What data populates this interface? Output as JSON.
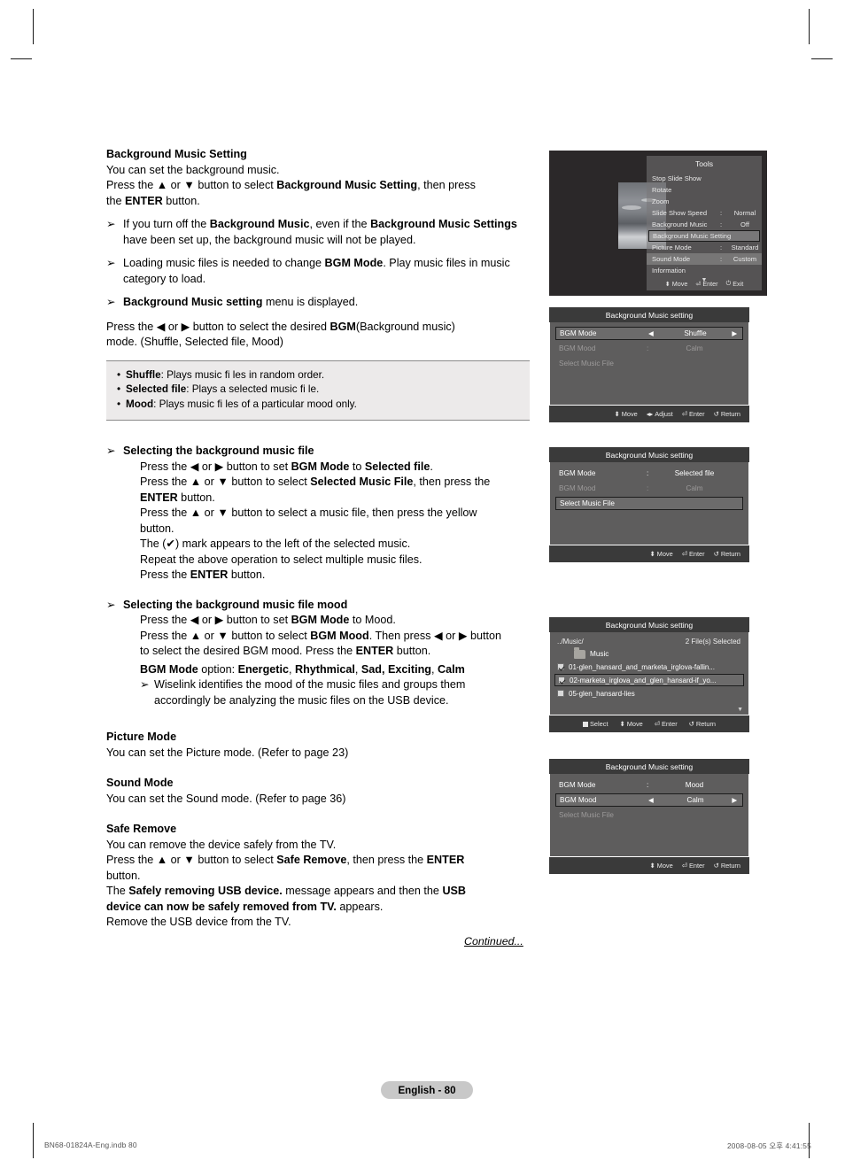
{
  "doc": {
    "page_badge": "English - 80",
    "continued": "Continued...",
    "footer_left": "BN68-01824A-Eng.indb   80",
    "footer_right": "2008-08-05   오후 4:41:55"
  },
  "sections": {
    "bg_music_setting": {
      "title": "Background Music Setting",
      "line1": "You can set the background music.",
      "line2_a": "Press the ▲ or ▼ button to select ",
      "line2_b": "Background Music Setting",
      "line2_c": ", then press",
      "line3_a": "the ",
      "line3_b": "ENTER",
      "line3_c": " button.",
      "bullets": [
        {
          "a": "If you turn off the ",
          "b": "Background Music",
          "c": ", even if the ",
          "d": "Background Music",
          "e": "Settings",
          "f": " have been set up, the background music will not be played."
        },
        {
          "a": "Loading music files is needed to change ",
          "b": "BGM Mode",
          "c": ". Play music files in",
          "d": "music category to load."
        },
        {
          "a": "Background Music setting",
          "b": " menu is displayed."
        }
      ],
      "after_a": "Press the ◀ or ▶ button to select the desired ",
      "after_b": "BGM",
      "after_c": "(Background music)",
      "after_d": "mode. (Shuffle, Selected file, Mood)"
    },
    "infobox": [
      {
        "term": "Shuffle",
        "text": ": Plays music fi les in random order."
      },
      {
        "term": "Selected file",
        "text": ": Plays a selected music fi le."
      },
      {
        "term": "Mood",
        "text": ": Plays music fi les of a particular mood only."
      }
    ],
    "selecting_file": {
      "heading": "Selecting the background music file",
      "l1_a": "Press the ◀ or ▶ button to set ",
      "l1_b": "BGM Mode",
      "l1_c": " to ",
      "l1_d": "Selected file",
      "l1_e": ".",
      "l2_a": "Press the ▲ or ▼ button to select ",
      "l2_b": "Selected Music File",
      "l2_c": ", then press the",
      "l3_a": "ENTER",
      "l3_b": " button.",
      "l4": "Press the ▲ or ▼ button to select a music file, then press the yellow",
      "l5": "button.",
      "l6": "The (✔) mark appears to the left of the selected music.",
      "l7": "Repeat the above operation to select multiple music files.",
      "l8_a": "Press the ",
      "l8_b": "ENTER",
      "l8_c": " button."
    },
    "selecting_mood": {
      "heading": "Selecting the background music file mood",
      "l1_a": "Press the ◀ or ▶ button to set ",
      "l1_b": "BGM Mode",
      "l1_c": " to Mood.",
      "l2_a": "Press the ▲ or ▼ button to select ",
      "l2_b": "BGM Mood",
      "l2_c": ". Then press ◀ or ▶ button",
      "l3_a": "to select the desired BGM mood. Press the ",
      "l3_b": "ENTER",
      "l3_c": " button.",
      "opt_a": "BGM Mode",
      "opt_b": " option: ",
      "opt_c": "Energetic",
      "opt_d": ", ",
      "opt_e": "Rhythmical",
      "opt_f": ", ",
      "opt_g": "Sad, Exciting",
      "opt_h": ", ",
      "opt_i": "Calm",
      "note1": "Wiselink identifies the mood of the music files and groups them",
      "note2": "accordingly be analyzing the music files on the USB device."
    },
    "picture_mode": {
      "title": "Picture Mode",
      "text": "You can set the Picture mode. (Refer to page 23)"
    },
    "sound_mode": {
      "title": "Sound Mode",
      "text": "You can set the Sound mode. (Refer to page 36)"
    },
    "safe_remove": {
      "title": "Safe Remove",
      "l1": "You can remove the device safely from the TV.",
      "l2_a": "Press the ▲ or ▼ button to select ",
      "l2_b": "Safe Remove",
      "l2_c": ", then press the ",
      "l2_d": "ENTER",
      "l3": "button.",
      "l4_a": "The ",
      "l4_b": "Safely removing USB device.",
      "l4_c": " message appears and then the ",
      "l4_d": "USB",
      "l5_a": "device can now be safely removed from TV.",
      "l5_b": " appears.",
      "l6": "Remove the USB device from the TV."
    }
  },
  "screens": {
    "tools": {
      "title": "Tools",
      "items": [
        {
          "label": "Stop Slide Show",
          "colon": "",
          "value": "",
          "state": "normal"
        },
        {
          "label": "Rotate",
          "colon": "",
          "value": "",
          "state": "normal"
        },
        {
          "label": "Zoom",
          "colon": "",
          "value": "",
          "state": "normal"
        },
        {
          "label": "Slide Show Speed",
          "colon": ":",
          "value": "Normal",
          "state": "normal"
        },
        {
          "label": "Background Music",
          "colon": ":",
          "value": "Off",
          "state": "normal"
        },
        {
          "label": "Background Music Setting",
          "colon": "",
          "value": "",
          "state": "selected"
        },
        {
          "label": "Picture Mode",
          "colon": ":",
          "value": "Standard",
          "state": "normal"
        },
        {
          "label": "Sound Mode",
          "colon": ":",
          "value": "Custom",
          "state": "highlight"
        },
        {
          "label": "Information",
          "colon": "",
          "value": "",
          "state": "normal"
        }
      ],
      "scroll": "▼",
      "footer": [
        {
          "icon": "⬍",
          "label": "Move"
        },
        {
          "icon": "⏎",
          "label": "Enter"
        },
        {
          "icon": "⏻",
          "label": "Exit"
        }
      ]
    },
    "bgm_shuffle": {
      "title": "Background Music setting",
      "rows": [
        {
          "label": "BGM Mode",
          "colon": "",
          "value": "Shuffle",
          "arrows": true,
          "state": "selected"
        },
        {
          "label": "BGM Mood",
          "colon": ":",
          "value": "Calm",
          "arrows": false,
          "state": "dim"
        },
        {
          "label": "Select Music File",
          "colon": "",
          "value": "",
          "arrows": false,
          "state": "dim"
        }
      ],
      "footer": [
        {
          "icon": "⬍",
          "label": "Move"
        },
        {
          "icon": "◂▸",
          "label": "Adjust"
        },
        {
          "icon": "⏎",
          "label": "Enter"
        },
        {
          "icon": "↺",
          "label": "Return"
        }
      ]
    },
    "bgm_selected_file": {
      "title": "Background Music setting",
      "rows": [
        {
          "label": "BGM Mode",
          "colon": ":",
          "value": "Selected file",
          "arrows": false,
          "state": "normal"
        },
        {
          "label": "BGM Mood",
          "colon": ":",
          "value": "Calm",
          "arrows": false,
          "state": "dim"
        },
        {
          "label": "Select Music File",
          "colon": "",
          "value": "",
          "arrows": false,
          "state": "selected"
        }
      ],
      "footer": [
        {
          "icon": "⬍",
          "label": "Move"
        },
        {
          "icon": "⏎",
          "label": "Enter"
        },
        {
          "icon": "↺",
          "label": "Return"
        }
      ]
    },
    "bgm_file_list": {
      "title": "Background Music setting",
      "path": "../Music/",
      "count": "2 File(s) Selected",
      "folder": "Music",
      "files": [
        {
          "name": "01-glen_hansard_and_marketa_irglova-fallin...",
          "checked": true,
          "selected": false
        },
        {
          "name": "02-marketa_irglova_and_glen_hansard-if_yo...",
          "checked": true,
          "selected": true
        },
        {
          "name": "05-glen_hansard-lies",
          "checked": false,
          "selected": false
        }
      ],
      "scroll": "▼",
      "footer": [
        {
          "icon": "■",
          "label": "Select"
        },
        {
          "icon": "⬍",
          "label": "Move"
        },
        {
          "icon": "⏎",
          "label": "Enter"
        },
        {
          "icon": "↺",
          "label": "Return"
        }
      ]
    },
    "bgm_mood": {
      "title": "Background Music setting",
      "rows": [
        {
          "label": "BGM Mode",
          "colon": ":",
          "value": "Mood",
          "arrows": false,
          "state": "normal"
        },
        {
          "label": "BGM Mood",
          "colon": "",
          "value": "Calm",
          "arrows": true,
          "state": "selected"
        },
        {
          "label": "Select Music File",
          "colon": "",
          "value": "",
          "arrows": false,
          "state": "dim"
        }
      ],
      "footer": [
        {
          "icon": "⬍",
          "label": "Move"
        },
        {
          "icon": "⏎",
          "label": "Enter"
        },
        {
          "icon": "↺",
          "label": "Return"
        }
      ]
    }
  }
}
